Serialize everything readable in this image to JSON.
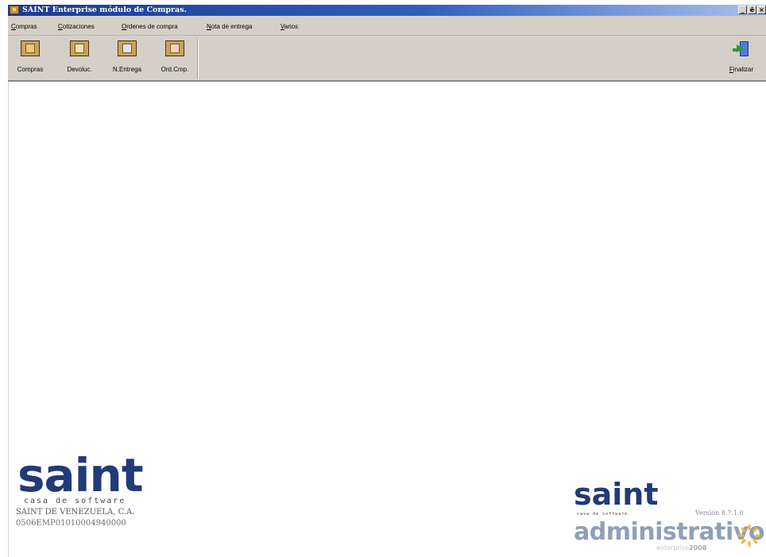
{
  "window": {
    "title": "SAINT Enterprise módulo de Compras.",
    "controls": [
      "_",
      "ê",
      "×"
    ]
  },
  "menu": {
    "items": [
      {
        "underline": "C",
        "rest": "ompras"
      },
      {
        "underline": "C",
        "rest": "otizaciones"
      },
      {
        "underline": "O",
        "rest": "rdenes de compra"
      },
      {
        "underline": "N",
        "rest": "ota de entrega"
      },
      {
        "underline": "V",
        "rest": "arios"
      }
    ]
  },
  "toolbar": {
    "buttons": [
      {
        "label": "Compras",
        "icon": "compras-icon"
      },
      {
        "label": "Devoluc.",
        "icon": "devoluciones-icon"
      },
      {
        "label": "N.Entrega",
        "icon": "nota-entrega-icon"
      },
      {
        "label": "Ord.Cmp.",
        "icon": "orden-compra-icon"
      }
    ],
    "exit_label_underline": "F",
    "exit_label_rest": "inalizar"
  },
  "branding": {
    "left_logo": "saint",
    "left_tagline": "casa de software",
    "company_name": "SAINT DE VENEZUELA, C.A.",
    "serial": "0506EMP01010004940000",
    "right_logo": "saint",
    "right_tagline": "casa de software",
    "product": "administrativo",
    "edition": "enterprise",
    "edition_year": "2008",
    "version": "Versión 8.7.1.0"
  },
  "colors": {
    "titlebar_start": "#1c3b8e",
    "titlebar_end": "#a9c2ec",
    "chrome": "#d4d0c8",
    "brand_blue": "#213a78",
    "brand_gray": "#8ea0b8"
  }
}
